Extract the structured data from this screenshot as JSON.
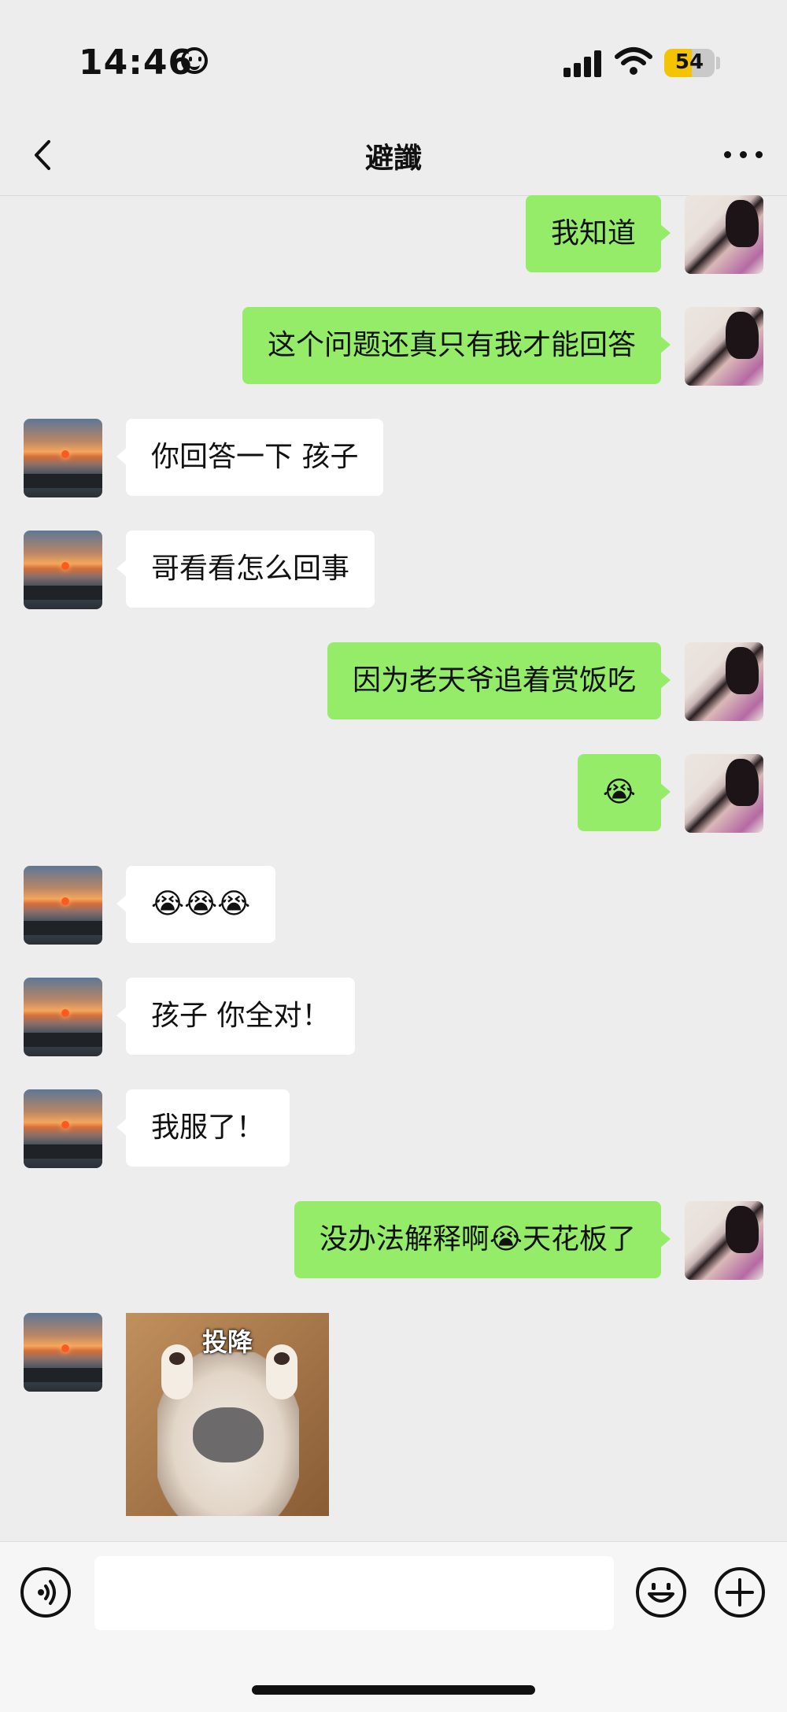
{
  "status_bar": {
    "time": "14:46",
    "battery": "54",
    "battery_level": 0.54,
    "icons": [
      "smiley-icon",
      "signal-icon",
      "wifi-icon",
      "battery-icon"
    ]
  },
  "nav": {
    "title": "避讖",
    "back_icon": "chevron-left-icon",
    "more_icon": "more-icon"
  },
  "messages": [
    {
      "side": "me",
      "text": "我知道"
    },
    {
      "side": "me",
      "text": "这个问题还真只有我才能回答"
    },
    {
      "side": "other",
      "text": "你回答一下 孩子"
    },
    {
      "side": "other",
      "text": "哥看看怎么回事"
    },
    {
      "side": "me",
      "text": "因为老天爷追着赏饭吃"
    },
    {
      "side": "me",
      "text": "😭"
    },
    {
      "side": "other",
      "text": "😭😭😭"
    },
    {
      "side": "other",
      "text": "孩子 你全对！"
    },
    {
      "side": "other",
      "text": "我服了！"
    },
    {
      "side": "me",
      "text": "没办法解释啊😭天花板了"
    },
    {
      "side": "other",
      "sticker_text": "投降"
    }
  ],
  "input_bar": {
    "value": "",
    "icons": [
      "voice-icon",
      "emoji-icon",
      "plus-icon"
    ]
  },
  "colors": {
    "background": "#ededed",
    "my_bubble": "#95ec69",
    "their_bubble": "#ffffff",
    "battery": "#f5c400"
  }
}
